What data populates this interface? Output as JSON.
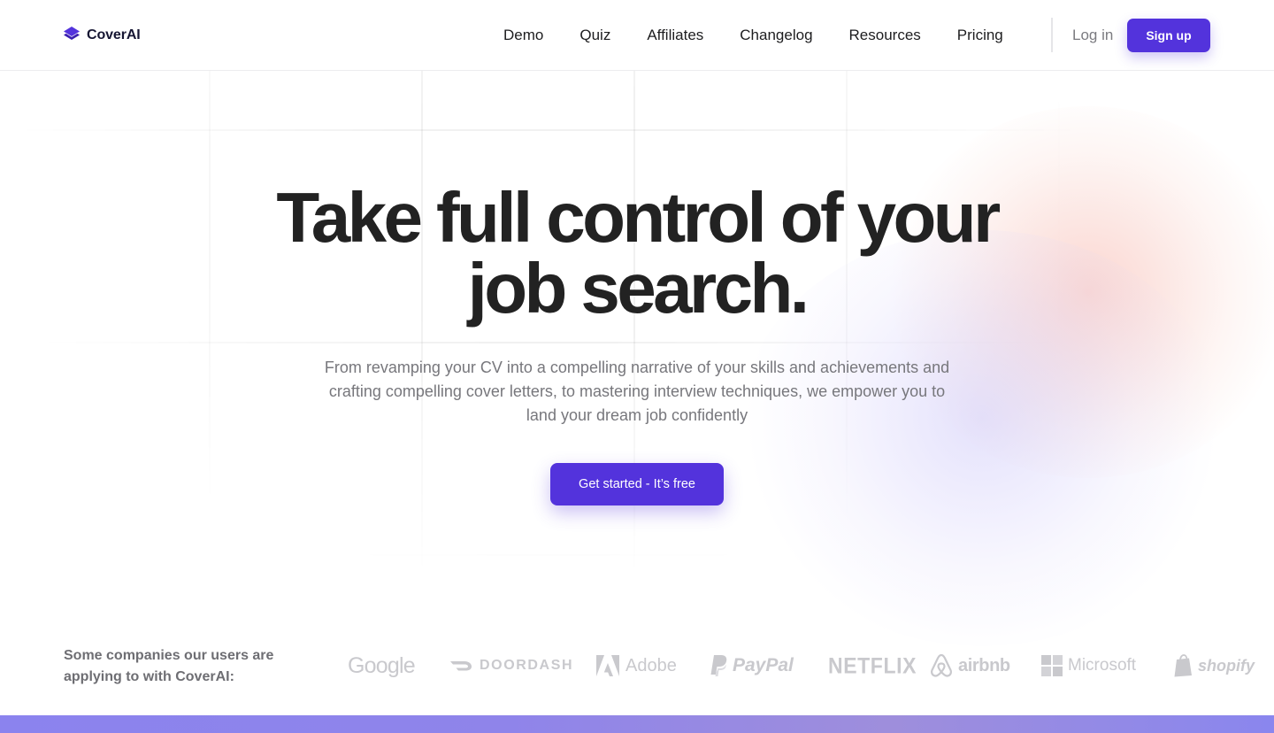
{
  "brand": {
    "name": "CoverAI"
  },
  "nav": {
    "items": [
      {
        "label": "Demo"
      },
      {
        "label": "Quiz"
      },
      {
        "label": "Affiliates"
      },
      {
        "label": "Changelog"
      },
      {
        "label": "Resources"
      },
      {
        "label": "Pricing"
      }
    ],
    "login_label": "Log in",
    "signup_label": "Sign up"
  },
  "hero": {
    "title_line1": "Take full control of your",
    "title_line2": "job search.",
    "subtitle": "From revamping your CV into a compelling narrative of your skills and achievements and crafting compelling cover letters, to mastering interview techniques, we empower you to land your dream job confidently",
    "cta_label": "Get started - It’s free"
  },
  "companies": {
    "label": "Some companies our users are applying to with CoverAI:",
    "logos": [
      {
        "name": "Google",
        "icon": "google-logo"
      },
      {
        "name": "DOORDASH",
        "icon": "doordash-logo"
      },
      {
        "name": "Adobe",
        "icon": "adobe-logo"
      },
      {
        "name": "PayPal",
        "icon": "paypal-logo"
      },
      {
        "name": "NETFLIX",
        "icon": "netflix-logo"
      },
      {
        "name": "airbnb",
        "icon": "airbnb-logo"
      },
      {
        "name": "Microsoft",
        "icon": "microsoft-logo"
      },
      {
        "name": "shopify",
        "icon": "shopify-logo"
      }
    ]
  },
  "colors": {
    "accent": "#5333dc",
    "heading": "#222222",
    "body_text": "#77777c",
    "logo_gray": "#c9c9cd",
    "bottom_band": "#8b83ee"
  }
}
